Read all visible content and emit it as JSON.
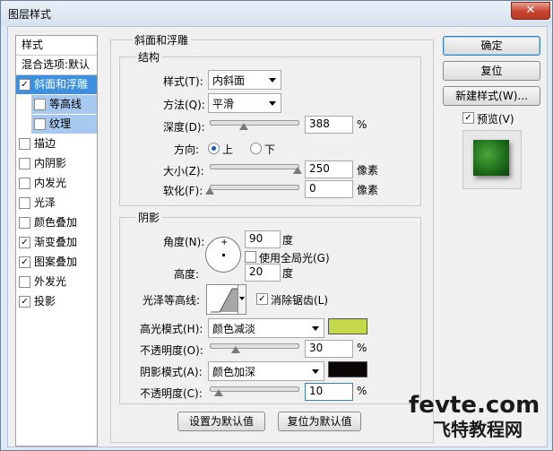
{
  "window": {
    "title": "图层样式",
    "close_glyph": "✕"
  },
  "left_panel": {
    "header": "样式",
    "items": [
      {
        "label": "混合选项:默认",
        "checkbox": false,
        "checked": false,
        "state": "normal"
      },
      {
        "label": "斜面和浮雕",
        "checkbox": true,
        "checked": true,
        "state": "selected"
      },
      {
        "label": "等高线",
        "checkbox": true,
        "checked": false,
        "state": "sub"
      },
      {
        "label": "纹理",
        "checkbox": true,
        "checked": false,
        "state": "sub"
      },
      {
        "label": "描边",
        "checkbox": true,
        "checked": false,
        "state": "normal"
      },
      {
        "label": "内阴影",
        "checkbox": true,
        "checked": false,
        "state": "normal"
      },
      {
        "label": "内发光",
        "checkbox": true,
        "checked": false,
        "state": "normal"
      },
      {
        "label": "光泽",
        "checkbox": true,
        "checked": false,
        "state": "normal"
      },
      {
        "label": "颜色叠加",
        "checkbox": true,
        "checked": false,
        "state": "normal"
      },
      {
        "label": "渐变叠加",
        "checkbox": true,
        "checked": true,
        "state": "normal"
      },
      {
        "label": "图案叠加",
        "checkbox": true,
        "checked": true,
        "state": "normal"
      },
      {
        "label": "外发光",
        "checkbox": true,
        "checked": false,
        "state": "normal"
      },
      {
        "label": "投影",
        "checkbox": true,
        "checked": true,
        "state": "normal"
      }
    ]
  },
  "bevel": {
    "section_title": "斜面和浮雕",
    "structure_title": "结构",
    "style_label": "样式(T):",
    "style_value": "内斜面",
    "method_label": "方法(Q):",
    "method_value": "平滑",
    "depth_label": "深度(D):",
    "depth_value": "388",
    "depth_unit": "%",
    "depth_slider": 0.39,
    "direction_label": "方向:",
    "dir_up": "上",
    "dir_down": "下",
    "direction_selected": "上",
    "size_label": "大小(Z):",
    "size_value": "250",
    "size_unit": "像素",
    "size_slider": 1.0,
    "soften_label": "软化(F):",
    "soften_value": "0",
    "soften_unit": "像素",
    "soften_slider": 0.0
  },
  "shading": {
    "title": "阴影",
    "angle_label": "角度(N):",
    "angle_value": "90",
    "angle_unit": "度",
    "global_light_label": "使用全局光(G)",
    "global_light_checked": false,
    "altitude_label": "高度:",
    "altitude_value": "20",
    "altitude_unit": "度",
    "gloss_label": "光泽等高线:",
    "antialias_label": "消除锯齿(L)",
    "antialias_checked": true,
    "highlight_mode_label": "高光模式(H):",
    "highlight_mode_value": "颜色减淡",
    "highlight_color": "#c3d94a",
    "highlight_opacity_label": "不透明度(O):",
    "highlight_opacity_value": "30",
    "highlight_opacity_unit": "%",
    "highlight_opacity_slider": 0.3,
    "shadow_mode_label": "阴影模式(A):",
    "shadow_mode_value": "颜色加深",
    "shadow_color": "#0b0606",
    "shadow_opacity_label": "不透明度(C):",
    "shadow_opacity_value": "10",
    "shadow_opacity_unit": "%",
    "shadow_opacity_slider": 0.1
  },
  "bottom_buttons": {
    "set_default": "设置为默认值",
    "reset_default": "复位为默认值"
  },
  "right_buttons": {
    "ok": "确定",
    "reset": "复位",
    "new_style": "新建样式(W)...",
    "preview_label": "预览(V)",
    "preview_checked": true
  },
  "watermark": {
    "line1": "fevte.com",
    "line2": "飞特教程网"
  }
}
